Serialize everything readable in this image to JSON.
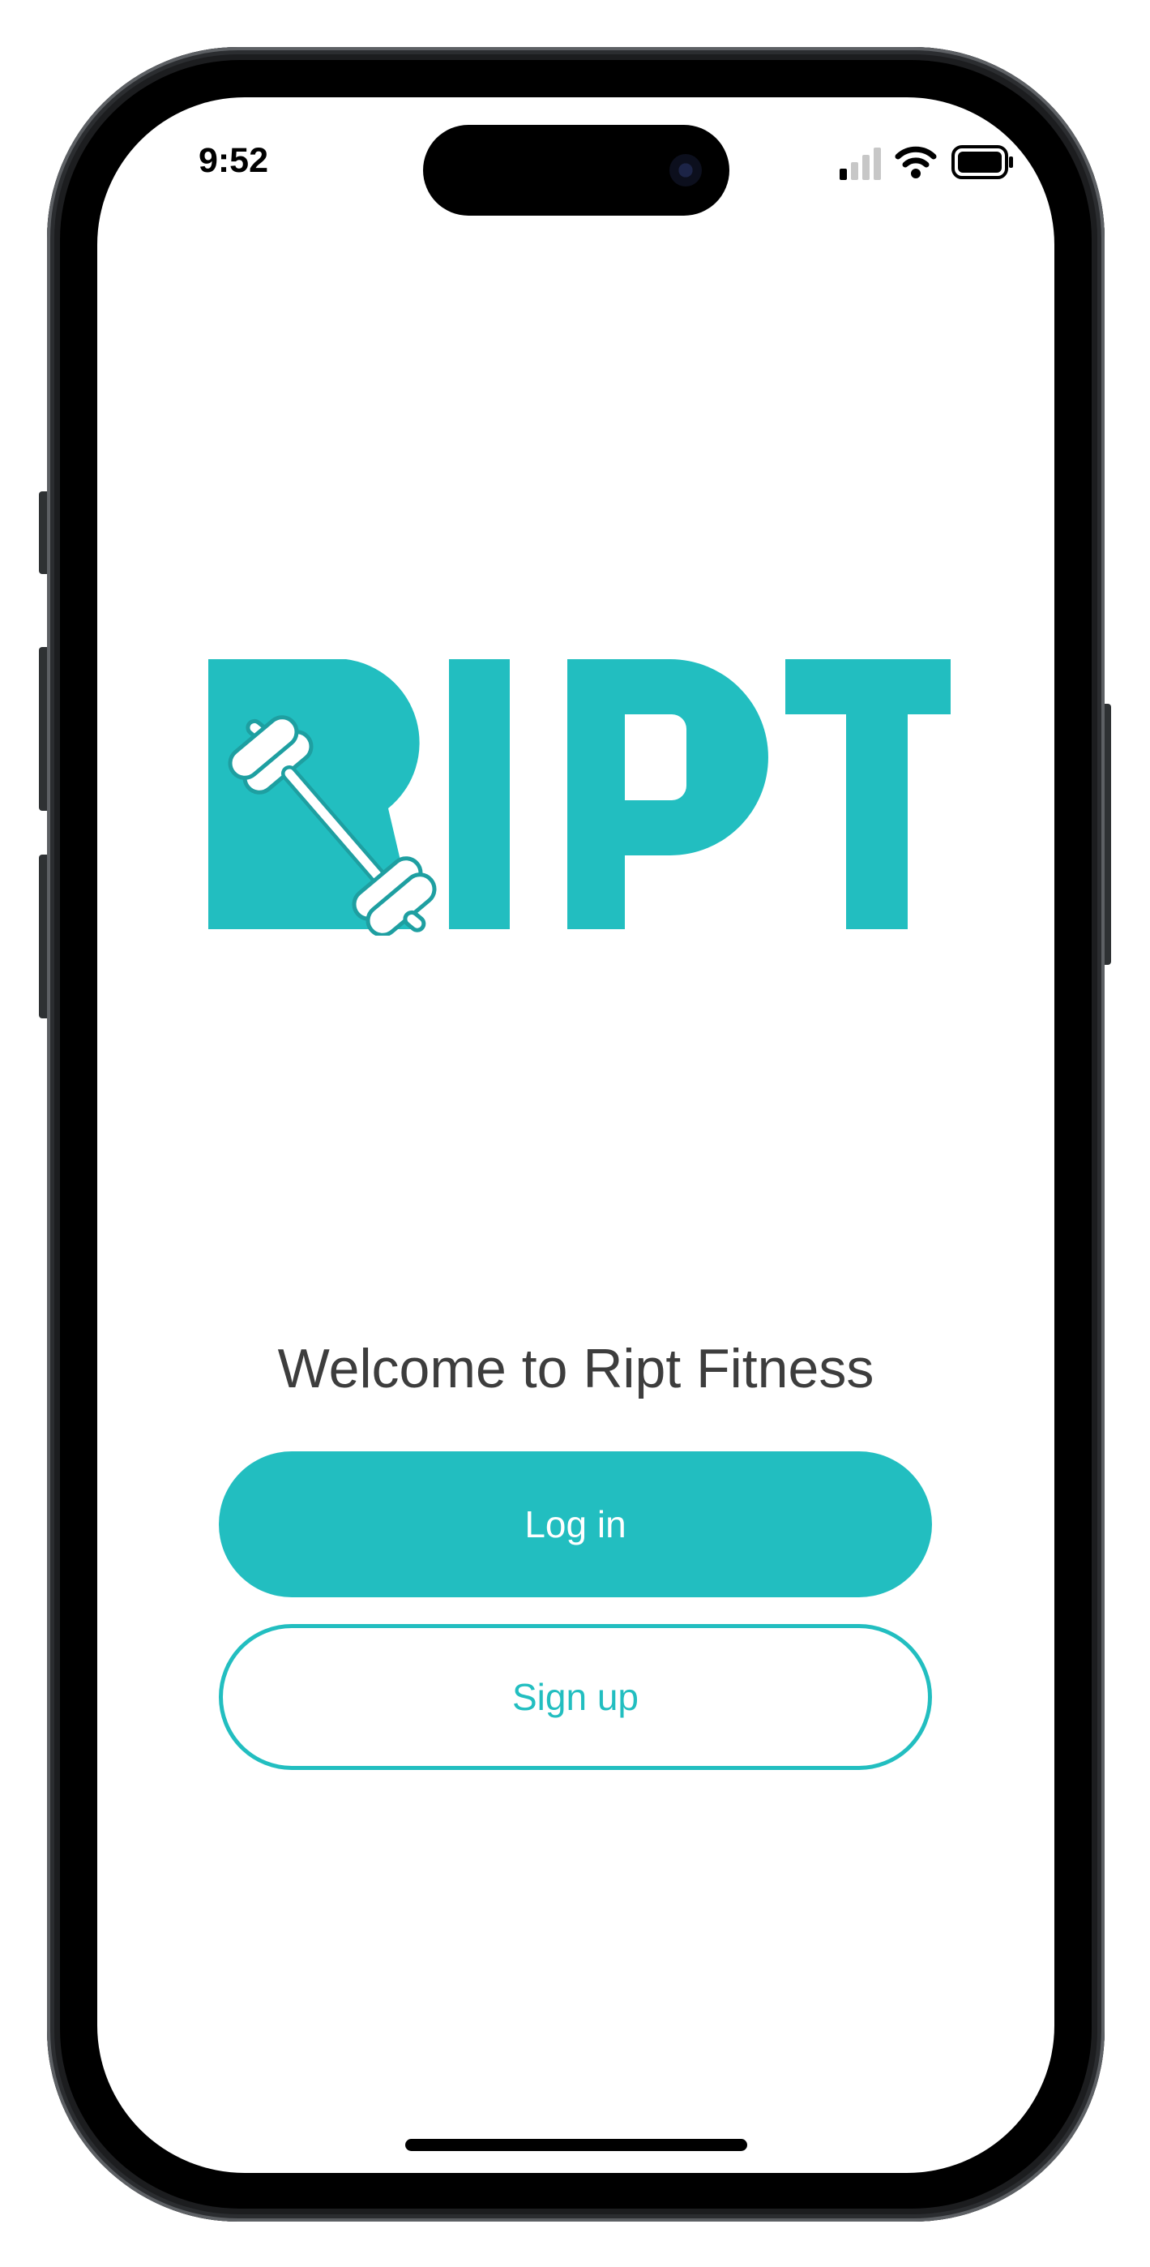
{
  "status_bar": {
    "time": "9:52",
    "icons": [
      "cellular-signal-icon",
      "wifi-icon",
      "battery-icon"
    ]
  },
  "app": {
    "logo_text": "RIPT",
    "welcome": "Welcome to Ript Fitness",
    "login_label": "Log in",
    "signup_label": "Sign up"
  },
  "colors": {
    "brand": "#22bec0",
    "text": "#3d3d3d",
    "background": "#ffffff"
  }
}
